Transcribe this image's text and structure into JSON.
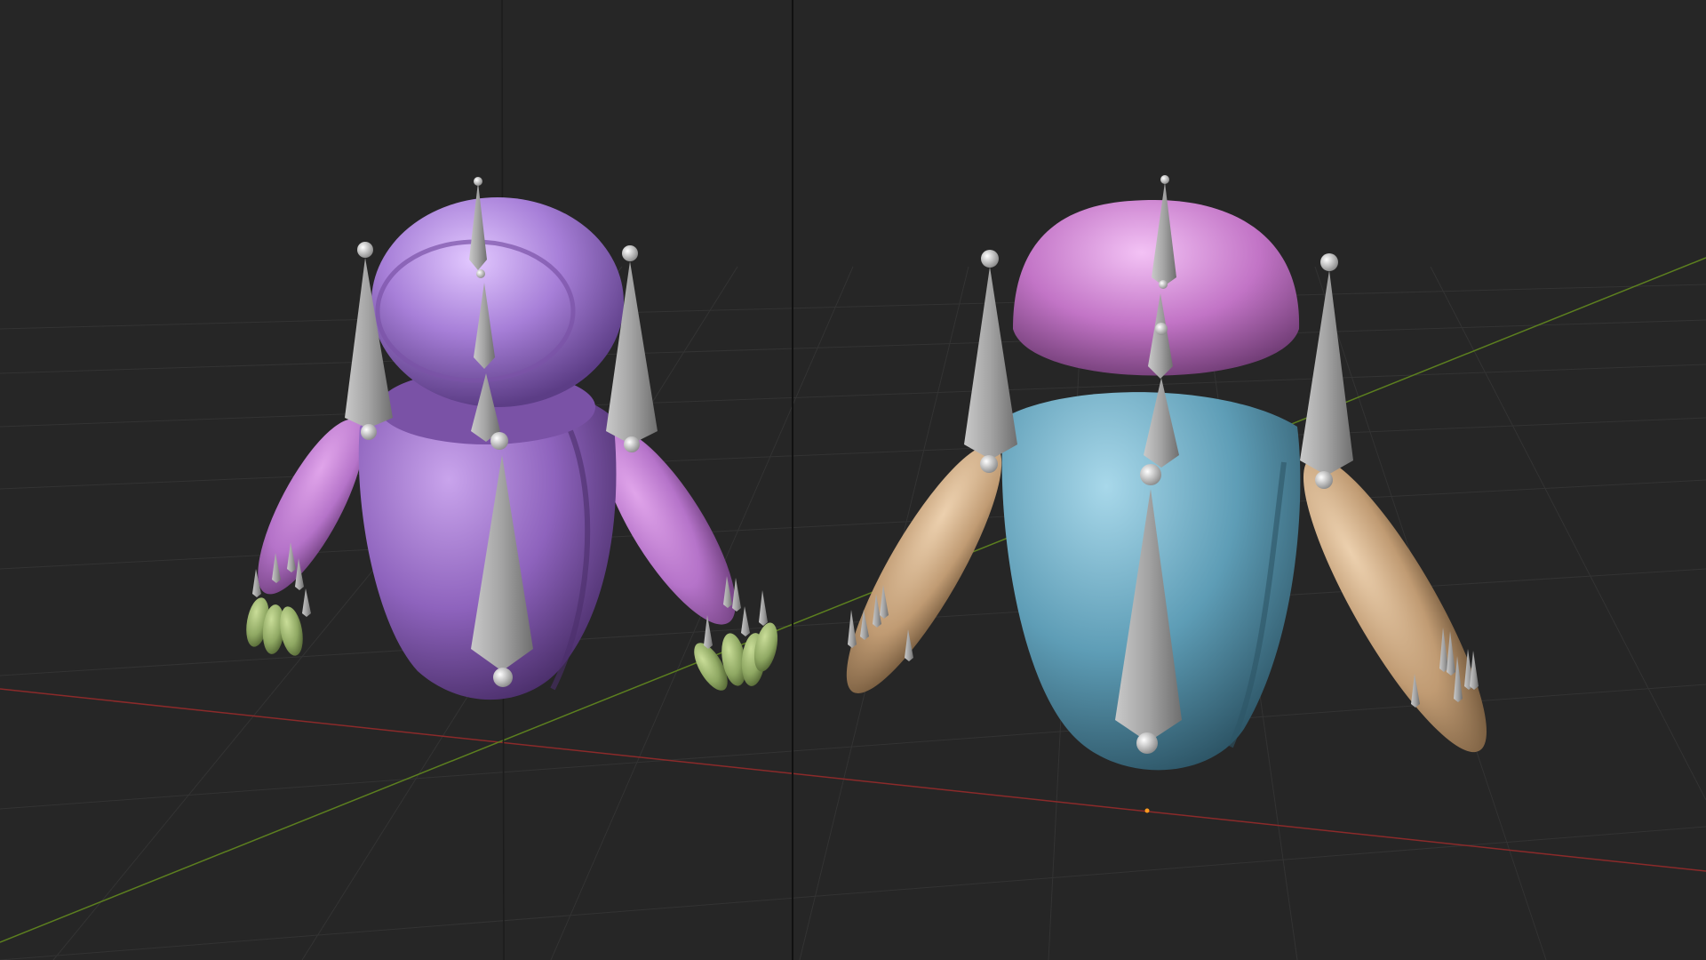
{
  "app": "3D viewport",
  "viewports": [
    {
      "id": "left",
      "character": "robot-purple",
      "colors": {
        "body": "#8e63bd",
        "head": "#a77fd8",
        "arms": "#b573c9",
        "fingers": "#8fa863"
      }
    },
    {
      "id": "right",
      "character": "robot-blue",
      "colors": {
        "body": "#5e9db6",
        "head": "#c274c6",
        "arms": "#c09b73"
      }
    }
  ],
  "theme": {
    "background": "#262626",
    "grid": "#343434",
    "x_axis": "#8b2a2a",
    "y_axis": "#5c7f1f",
    "bone": "#a7a7a7",
    "divider": "#111111"
  }
}
